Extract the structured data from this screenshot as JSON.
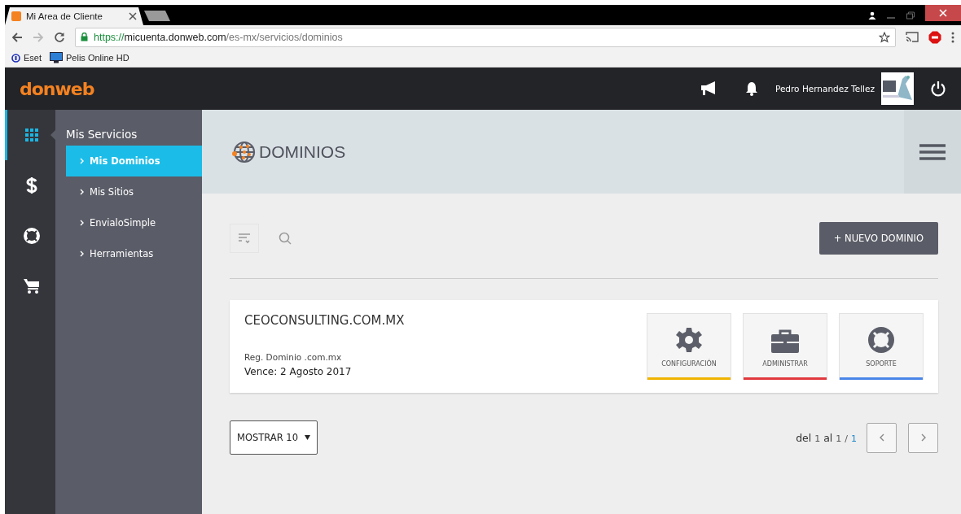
{
  "browser": {
    "tab_title": "Mi Area de Cliente",
    "url_scheme": "https://",
    "url_host": "micuenta.donweb.com",
    "url_path": "/es-mx/servicios/dominios",
    "bookmarks": [
      {
        "label": "Eset",
        "kind": "eset"
      },
      {
        "label": "Pelis Online HD",
        "kind": "monitor"
      }
    ]
  },
  "header": {
    "logo": "donweb",
    "user_name": "Pedro Hernandez Tellez"
  },
  "rail": [
    {
      "kind": "grid",
      "selected": true
    },
    {
      "kind": "dollar",
      "selected": false
    },
    {
      "kind": "lifebuoy",
      "selected": false
    },
    {
      "kind": "cart",
      "selected": false
    }
  ],
  "submenu": {
    "title": "Mis Servicios",
    "items": [
      {
        "label": "Mis Dominios",
        "selected": true
      },
      {
        "label": "Mis Sitios",
        "selected": false
      },
      {
        "label": "EnvialoSimple",
        "selected": false
      },
      {
        "label": "Herramientas",
        "selected": false
      }
    ]
  },
  "page_title": "DOMINIOS",
  "new_button": "+ NUEVO DOMINIO",
  "domains": [
    {
      "name": "CEOCONSULTING.COM.MX",
      "type": "Reg. Dominio .com.mx",
      "expires": "Vence: 2 Agosto 2017",
      "actions": [
        {
          "label": "CONFIGURACIÓN",
          "kind": "gear",
          "color": "#f0b400"
        },
        {
          "label": "ADMINISTRAR",
          "kind": "briefcase",
          "color": "#e0393e"
        },
        {
          "label": "SOPORTE",
          "kind": "lifebuoy",
          "color": "#4a86e8"
        }
      ]
    }
  ],
  "page_size": "MOSTRAR 10",
  "pagination": {
    "w1": "del",
    "from": "1",
    "w2": "al",
    "to": "1",
    "sep": "/",
    "total": "1"
  }
}
